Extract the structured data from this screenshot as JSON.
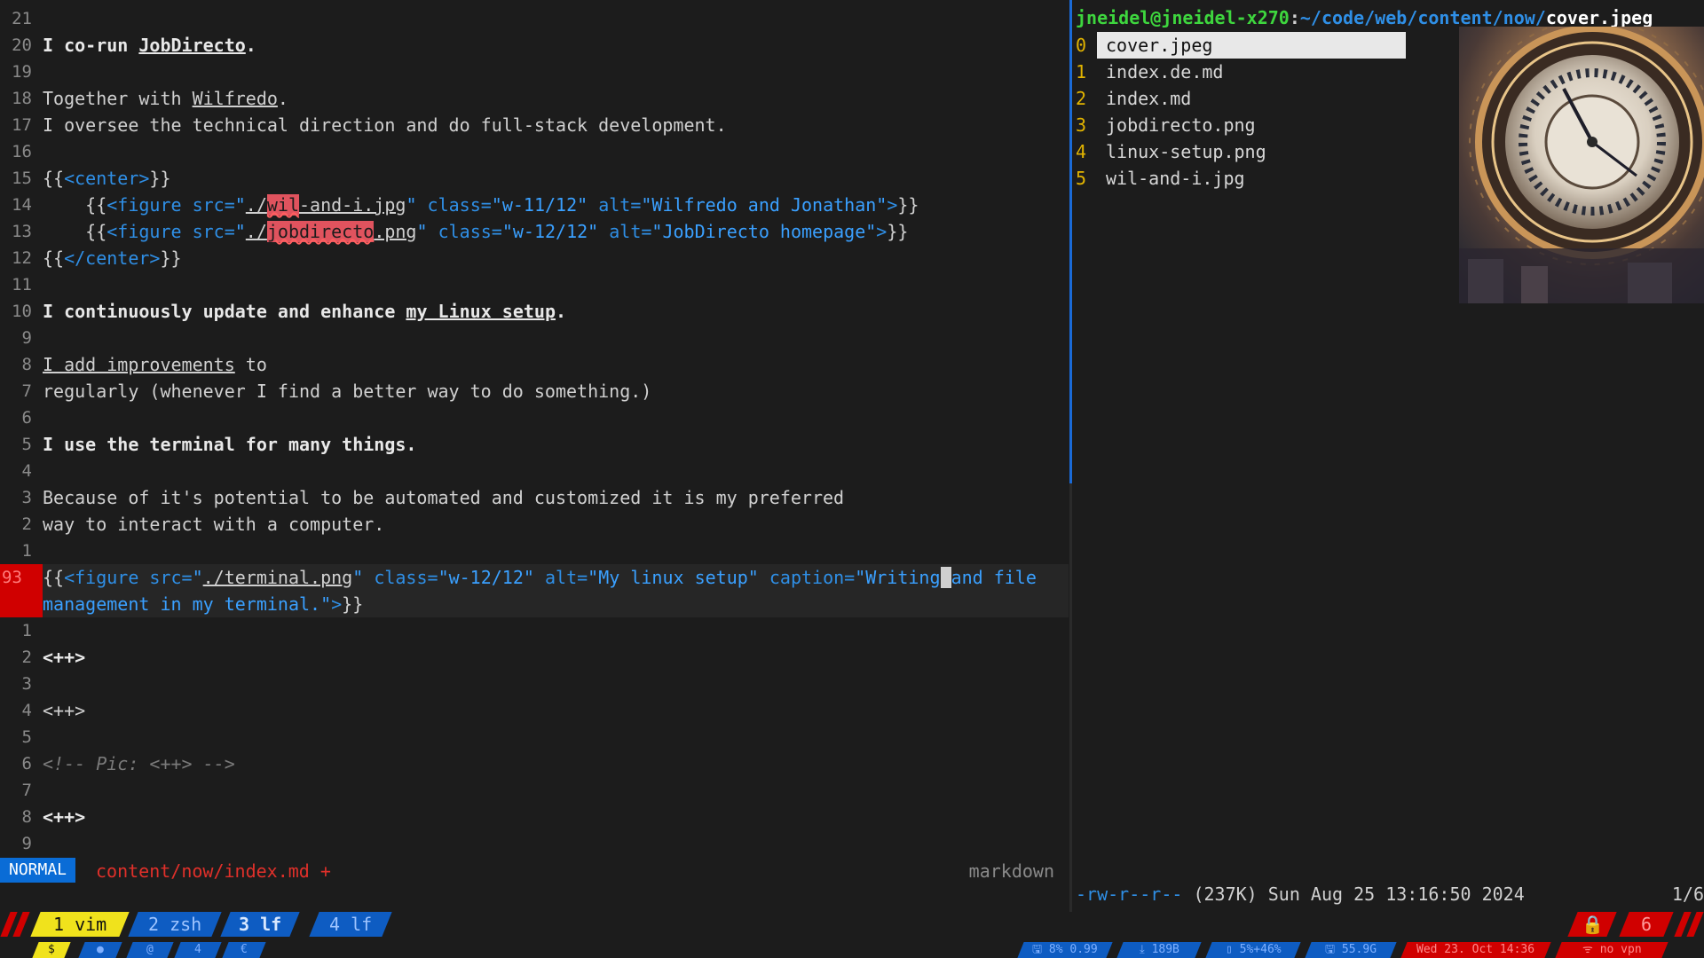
{
  "vim": {
    "lines": [
      {
        "ln": "21"
      },
      {
        "ln": "20",
        "parts": [
          [
            "b",
            "I co-run "
          ],
          [
            "b u",
            "JobDirecto"
          ],
          [
            "b",
            "."
          ]
        ]
      },
      {
        "ln": "19"
      },
      {
        "ln": "18",
        "parts": [
          [
            "",
            "Together with "
          ],
          [
            "u",
            "Wilfredo"
          ],
          [
            "",
            "."
          ]
        ]
      },
      {
        "ln": "17",
        "parts": [
          [
            "",
            "I oversee the technical direction and do full-stack development."
          ]
        ]
      },
      {
        "ln": "16"
      },
      {
        "ln": "15",
        "parts": [
          [
            "",
            "{{"
          ],
          [
            "tag",
            "<center>"
          ],
          [
            "",
            "}}"
          ]
        ]
      },
      {
        "ln": "14",
        "parts": [
          [
            "",
            "    {{"
          ],
          [
            "tag",
            "<figure "
          ],
          [
            "attr",
            "src="
          ],
          [
            "str",
            "\""
          ],
          [
            "path",
            "./"
          ],
          [
            "err",
            "wil"
          ],
          [
            "path",
            "-and-i.jpg"
          ],
          [
            "str",
            "\" "
          ],
          [
            "attr",
            "class="
          ],
          [
            "str",
            "\"w-11/12\" "
          ],
          [
            "attr",
            "alt="
          ],
          [
            "str",
            "\"Wilfredo and Jonathan\""
          ],
          [
            "tag",
            ">"
          ],
          [
            "",
            "}}"
          ]
        ]
      },
      {
        "ln": "13",
        "parts": [
          [
            "",
            "    {{"
          ],
          [
            "tag",
            "<figure "
          ],
          [
            "attr",
            "src="
          ],
          [
            "str",
            "\""
          ],
          [
            "path",
            "./"
          ],
          [
            "err",
            "jobdirecto"
          ],
          [
            "path",
            ".png"
          ],
          [
            "str",
            "\" "
          ],
          [
            "attr",
            "class="
          ],
          [
            "str",
            "\"w-12/12\" "
          ],
          [
            "attr",
            "alt="
          ],
          [
            "str",
            "\"JobDirecto homepage\""
          ],
          [
            "tag",
            ">"
          ],
          [
            "",
            "}}"
          ]
        ]
      },
      {
        "ln": "12",
        "parts": [
          [
            "",
            "{{"
          ],
          [
            "tag",
            "</center>"
          ],
          [
            "",
            "}}"
          ]
        ]
      },
      {
        "ln": "11"
      },
      {
        "ln": "10",
        "parts": [
          [
            "b",
            "I continuously update and enhance "
          ],
          [
            "b u",
            "my Linux setup"
          ],
          [
            "b",
            "."
          ]
        ]
      },
      {
        "ln": "9"
      },
      {
        "ln": "8",
        "parts": [
          [
            "u",
            "I add improvements"
          ],
          [
            "",
            " to"
          ]
        ]
      },
      {
        "ln": "7",
        "parts": [
          [
            "",
            "regularly (whenever I find a better way to do something.)"
          ]
        ]
      },
      {
        "ln": "6"
      },
      {
        "ln": "5",
        "parts": [
          [
            "b",
            "I use the terminal for many things."
          ]
        ]
      },
      {
        "ln": "4"
      },
      {
        "ln": "3",
        "parts": [
          [
            "",
            "Because of it's potential to be automated and customized it is my preferred"
          ]
        ]
      },
      {
        "ln": "2",
        "parts": [
          [
            "",
            "way to interact with a computer."
          ]
        ]
      },
      {
        "ln": "1"
      }
    ],
    "current": {
      "ln": "93",
      "line1": [
        [
          "",
          "{{"
        ],
        [
          "tag",
          "<figure "
        ],
        [
          "attr",
          "src="
        ],
        [
          "str",
          "\""
        ],
        [
          "path",
          "./terminal.png"
        ],
        [
          "str",
          "\" "
        ],
        [
          "attr",
          "class="
        ],
        [
          "str",
          "\"w-12/12\" "
        ],
        [
          "attr",
          "alt="
        ],
        [
          "str",
          "\"My linux setup\" "
        ],
        [
          "attr",
          "caption="
        ],
        [
          "str",
          "\"Writing"
        ],
        [
          "cursor",
          " "
        ],
        [
          "str",
          "and file"
        ]
      ],
      "line2": [
        [
          "str",
          "management in my terminal.\""
        ],
        [
          "tag",
          ">"
        ],
        [
          "",
          "}}"
        ]
      ]
    },
    "after": [
      {
        "ln": "1"
      },
      {
        "ln": "2",
        "parts": [
          [
            "b",
            "<++>"
          ]
        ]
      },
      {
        "ln": "3"
      },
      {
        "ln": "4",
        "parts": [
          [
            "",
            "<++>"
          ]
        ]
      },
      {
        "ln": "5"
      },
      {
        "ln": "6",
        "parts": [
          [
            "cmt",
            "<!-- Pic: <++> -->"
          ]
        ]
      },
      {
        "ln": "7"
      },
      {
        "ln": "8",
        "parts": [
          [
            "b",
            "<++>"
          ]
        ]
      },
      {
        "ln": "9"
      }
    ],
    "status": {
      "mode": "NORMAL",
      "file": "content/now/index.md +",
      "filetype": "markdown"
    }
  },
  "lf": {
    "title_user": "jneidel@jneidel-x270",
    "title_sep": ":",
    "title_dir": "~/code/web/content/now/",
    "title_file": "cover.jpeg",
    "entries": [
      {
        "idx": "0",
        "name": "cover.jpeg",
        "selected": true
      },
      {
        "idx": "1",
        "name": "index.de.md"
      },
      {
        "idx": "2",
        "name": "index.md"
      },
      {
        "idx": "3",
        "name": "jobdirecto.png"
      },
      {
        "idx": "4",
        "name": "linux-setup.png"
      },
      {
        "idx": "5",
        "name": "wil-and-i.jpg"
      }
    ],
    "status_perm": "-rw-r--r--",
    "status_info": " (237K) Sun Aug 25 13:16:50 2024",
    "position": "1/6"
  },
  "tmux": {
    "windows": [
      {
        "label": "1 vim"
      },
      {
        "label": "2 zsh"
      },
      {
        "label": "3 lf"
      },
      {
        "label": "4 lf"
      }
    ],
    "right_lock": "🔒",
    "right_count": "6",
    "row2_left": [
      "$",
      "●",
      "@",
      "4",
      "€"
    ],
    "row2_right": [
      "🖫 8% 0.99",
      "⤓ 189B",
      "▯ 5%+46%",
      "🖫 55.9G",
      "Wed 23. Oct 14:36",
      "ᯤ no vpn"
    ]
  },
  "colors": {
    "accent": "#0e5cc2",
    "warning": "#d00000",
    "highlight": "#f0e21c"
  }
}
